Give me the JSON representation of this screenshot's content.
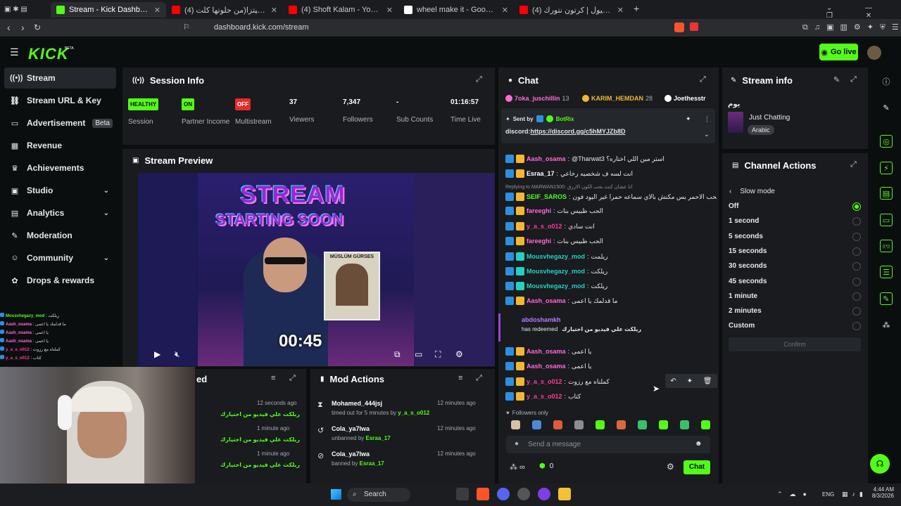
{
  "browser": {
    "tabs": [
      {
        "title": "Stream - Kick Dashboard",
        "color": "#53fc18",
        "active": true
      },
      {
        "title": "(4) محمد هنيدي البيتزا(من حلوتها كلت ...",
        "color": "#ff0000"
      },
      {
        "title": "(4) Shoft Kalam - YouTube",
        "color": "#ff0000"
      },
      {
        "title": "wheel make it - Google Search",
        "color": "#ffffff"
      },
      {
        "title": "(4) حلقة - العمل | عاميول | كرتون نتورك",
        "color": "#ff0000"
      }
    ],
    "url": "dashboard.kick.com/stream"
  },
  "header": {
    "logo": "KICK",
    "logo_tag": "BETA",
    "go_live": "Go live"
  },
  "sidebar": {
    "items": [
      {
        "label": "Stream",
        "icon": "broadcast-icon",
        "glyph": "((•))"
      },
      {
        "label": "Stream URL & Key",
        "icon": "link-icon",
        "glyph": "⛓"
      },
      {
        "label": "Advertisement",
        "icon": "monitor-icon",
        "glyph": "▭",
        "badge": "Beta"
      },
      {
        "label": "Revenue",
        "icon": "dollar-icon",
        "glyph": "▦"
      },
      {
        "label": "Achievements",
        "icon": "trophy-icon",
        "glyph": "♛"
      },
      {
        "label": "Studio",
        "icon": "camera-icon",
        "glyph": "▣"
      },
      {
        "label": "Analytics",
        "icon": "chart-icon",
        "glyph": "▤"
      },
      {
        "label": "Moderation",
        "icon": "wrench-icon",
        "glyph": "✎"
      },
      {
        "label": "Community",
        "icon": "users-icon",
        "glyph": "☺"
      },
      {
        "label": "Drops & rewards",
        "icon": "gift-icon",
        "glyph": "✿"
      }
    ]
  },
  "overlay_chat": [
    {
      "name": "Mousvhegazy_mod",
      "msg": "ريلكت",
      "color": "#53fc18"
    },
    {
      "name": "Aash_osama",
      "msg": "ما قدلمك يا اعمى",
      "color": "#ff6ad5"
    },
    {
      "name": "Aash_osama",
      "msg": "يا اعمى",
      "color": "#ff6ad5"
    },
    {
      "name": "Aash_osama",
      "msg": "يا اعمى",
      "color": "#ff6ad5"
    },
    {
      "name": "y_a_s_o012",
      "msg": "كملناه مع رزوت",
      "color": "#ff3b9a"
    },
    {
      "name": "y_a_s_o012",
      "msg": "كتاب",
      "color": "#ff3b9a"
    }
  ],
  "session": {
    "title": "Session Info",
    "stats": [
      {
        "badge": "HEALTHY",
        "label": "Session",
        "badge_color": "#53fc18",
        "text_color": "#0b0e0f"
      },
      {
        "badge": "ON",
        "label": "Partner Income",
        "badge_color": "#53fc18",
        "text_color": "#0b0e0f"
      },
      {
        "badge": "OFF",
        "label": "Multistream",
        "badge_color": "#e62b2b",
        "text_color": "#ffffff"
      },
      {
        "value": "37",
        "label": "Viewers"
      },
      {
        "value": "7,347",
        "label": "Followers"
      },
      {
        "value": "-",
        "label": "Sub Counts"
      },
      {
        "value": "01:16:57",
        "label": "Time Live"
      }
    ]
  },
  "preview": {
    "title": "Stream Preview",
    "line1": "STREAM",
    "line2": "STARTING SOON",
    "countdown": "00:45",
    "poster_name": "MÜSLÜM GÜRSES"
  },
  "recent": {
    "title_tail": "ed",
    "rows": [
      {
        "time": "12 seconds ago",
        "text": "ريلكت علي فيديو من اختيارك"
      },
      {
        "time": "1 minute ago",
        "text": "ريلكت علي فيديو من اختيارك"
      },
      {
        "time": "1 minute ago",
        "text": "ريلكت علي فيديو من اختيارك"
      }
    ]
  },
  "mod": {
    "title": "Mod Actions",
    "rows": [
      {
        "icon": "hourglass-icon",
        "glyph": "⧗",
        "name": "Mohamed_444jsj",
        "sub": "timed out for 5 minutes by",
        "by": "y_a_s_o012",
        "time": "12 minutes ago"
      },
      {
        "icon": "undo-icon",
        "glyph": "↺",
        "name": "Cola_ya7lwa",
        "sub": "unbanned by",
        "by": "Esraa_17",
        "time": "12 minutes ago"
      },
      {
        "icon": "ban-icon",
        "glyph": "⊘",
        "name": "Cola_ya7lwa",
        "sub": "banned by",
        "by": "Esraa_17",
        "time": "12 minutes ago"
      }
    ]
  },
  "chat": {
    "title": "Chat",
    "leaders": [
      {
        "name": "7oka_juschillin",
        "count": "13",
        "color": "#ff6ad5"
      },
      {
        "name": "KARIM_HEMDAN",
        "count": "28",
        "color": "#f5b731"
      },
      {
        "name": "Joethesstr",
        "count": "",
        "color": "#ffffff"
      }
    ],
    "pinned": {
      "sent_by": "Sent by",
      "bot": "BotRix",
      "prefix": "discord:",
      "link": "https://discord.gg/c5hMYJZb8D"
    },
    "lines": [
      {
        "name": "Aash_osama",
        "msg": "@Tharwat3 استر مين اللي اختاره؟",
        "color": "#ff6ad5"
      },
      {
        "name": "Esraa_17",
        "msg": "انت لسه ف شخصيه رخاعي",
        "color": "#ffffff"
      },
      {
        "name": "SEIF_SAROS",
        "msg": "انا بحب الاحمر بس مكنش بالاي سماعه حمرا غير اليود فون",
        "color": "#53fc18",
        "reply": "Replying to MARWAN1500: انا عشان كنت بحب اللون الازرق"
      },
      {
        "name": "fareeghi",
        "msg": "الحب ظبيس بنات",
        "color": "#ff6ad5"
      },
      {
        "name": "y_a_s_o012",
        "msg": "انت سادي",
        "color": "#ff3b9a"
      },
      {
        "name": "fareeghi",
        "msg": "الحب ظبيس بنات",
        "color": "#ff6ad5"
      },
      {
        "name": "Mousvhegazy_mod",
        "msg": "ريلمت",
        "color": "#25d0c3"
      },
      {
        "name": "Mousvhegazy_mod",
        "msg": "ريلكت",
        "color": "#25d0c3"
      },
      {
        "name": "Mousvhegazy_mod",
        "msg": "ريلكت",
        "color": "#25d0c3"
      },
      {
        "name": "Aash_osama",
        "msg": "ما قدلمك يا اعمى",
        "color": "#ff6ad5"
      }
    ],
    "redeem": {
      "name": "abdoshamkh",
      "text": "has redeemed",
      "reward": "ريلكت علي فيديو من اختيارك"
    },
    "lines2": [
      {
        "name": "Aash_osama",
        "msg": "يا اعمى",
        "color": "#ff6ad5"
      },
      {
        "name": "Aash_osama",
        "msg": "يا اعمى",
        "color": "#ff6ad5"
      },
      {
        "name": "y_a_s_o012",
        "msg": "كملناه مع رزوت",
        "color": "#ff3b9a"
      },
      {
        "name": "y_a_s_o012",
        "msg": "كتاب",
        "color": "#ff3b9a"
      }
    ],
    "followers_only": "Followers only",
    "placeholder": "Send a message",
    "count": "0",
    "send": "Chat"
  },
  "stream_info": {
    "title": "Stream info",
    "stream_title": "يوم",
    "category": "Just Chatting",
    "tag": "Arabic"
  },
  "channel_actions": {
    "title": "Channel Actions",
    "sub": "Slow mode",
    "options": [
      "Off",
      "1 second",
      "5 seconds",
      "15 seconds",
      "30 seconds",
      "45 seconds",
      "1 minute",
      "2 minutes",
      "Custom"
    ],
    "selected": "Off",
    "confirm": "Confirm"
  },
  "taskbar": {
    "search": "Search",
    "lang": "ENG",
    "time": "4:44 AM",
    "date": "8/3/2026"
  },
  "colors": {
    "accent": "#53fc18",
    "panel": "#191b1f",
    "bg": "#0b0e0f"
  }
}
